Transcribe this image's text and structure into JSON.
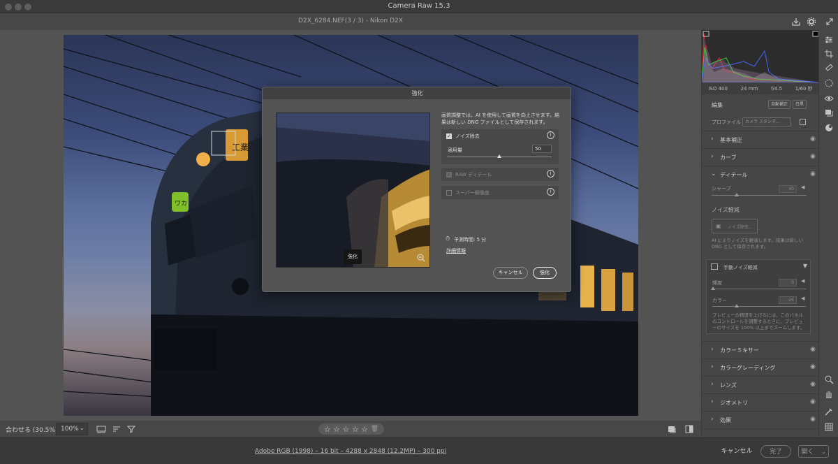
{
  "window": {
    "title": "Camera Raw 15.3"
  },
  "header": {
    "filename": "D2X_6284.NEF(3 / 3)  -  Nikon D2X",
    "save_icon": "download-icon",
    "settings_icon": "gear-icon",
    "expand_icon": "expand-icon"
  },
  "photo": {
    "sign_text": "工業",
    "plate_text": "ワカ"
  },
  "bottombar": {
    "zoom_fit_label": "合わせる (30.5%)",
    "zoom_value": "100%",
    "zoom_chevron": "⌄",
    "star_rating": "☆ ☆ ☆ ☆ ☆",
    "trash_icon": "🗑"
  },
  "footer": {
    "file_info": "Adobe RGB (1998) – 16 bit – 4288 x 2848 (12.2MP) – 300 ppi",
    "cancel_label": "キャンセル",
    "done_label": "完了",
    "open_label": "開く"
  },
  "panel": {
    "exif": [
      "ISO 400",
      "24 mm",
      "f/4.5",
      "1/60 秒"
    ],
    "edit_title": "編集",
    "auto_label": "自動補正",
    "bw_label": "白黒",
    "profile_label": "プロファイル",
    "profile_value": "カメラ スタンダ…",
    "sections": {
      "basic": "基本補正",
      "curve": "カーブ",
      "detail": "ディテール",
      "mixer": "カラーミキサー",
      "grading": "カラーグレーディング",
      "lens": "レンズ",
      "geometry": "ジオメトリ",
      "effects": "効果"
    },
    "sharpen_label": "シャープ",
    "sharpen_value": "40",
    "noise_title": "ノイズ軽減",
    "noise_button": "ノイズ除去...",
    "noise_desc": "AI によりノイズを軽減します。結果は新しい DNG として保存されます。",
    "manual_noise": "手動ノイズ軽減",
    "luminance_label": "輝度",
    "luminance_value": "0",
    "color_label": "カラー",
    "color_value": "25",
    "preview_hint": "プレビューの精度を上げるには、このパネルのコントロールを調整するときに、プレビューのサイズを 100% 以上までズームします。"
  },
  "dialog": {
    "title": "強化",
    "description": "画質調整では、AI を使用して画質を向上させます。結果は新しい DNG ファイルとして保存されます。",
    "denoise_label": "ノイズ除去",
    "amount_label": "適用量",
    "amount_value": "50",
    "amount_level": 0.5,
    "raw_detail_label": "RAW ディテール",
    "super_res_label": "スーパー解像度",
    "estimate": "予測時間: 5 分",
    "more_info": "詳細情報",
    "preview_badge": "強化",
    "cancel_label": "キャンセル",
    "enhance_label": "強化"
  }
}
